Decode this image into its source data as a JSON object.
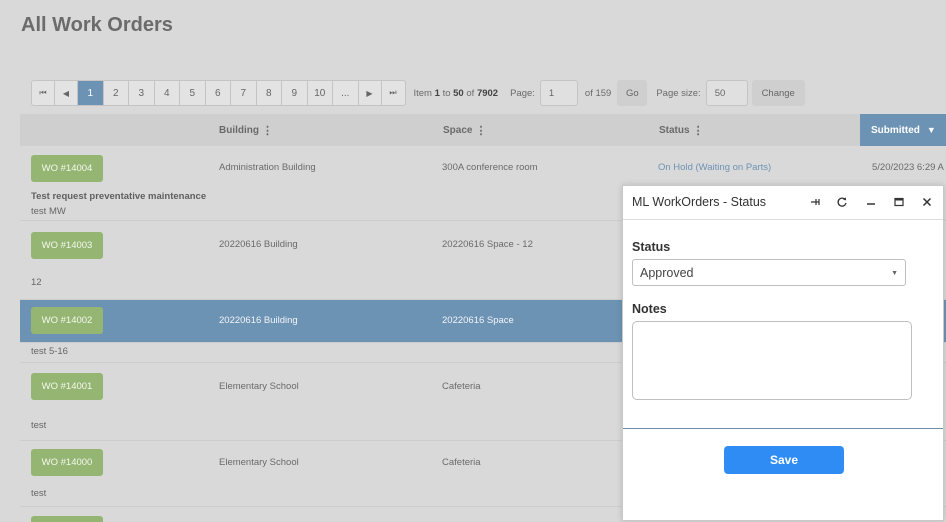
{
  "page": {
    "title": "All Work Orders"
  },
  "pager": {
    "first_icon": "⏮",
    "prev_icon": "◀",
    "pages": [
      "1",
      "2",
      "3",
      "4",
      "5",
      "6",
      "7",
      "8",
      "9",
      "10",
      "..."
    ],
    "next_icon": "▶",
    "last_icon": "⏭",
    "item_prefix": "Item",
    "item_from": "1",
    "item_to_word": "to",
    "item_to": "50",
    "item_of_word": "of",
    "item_total": "7902",
    "page_label": "Page:",
    "page_value": "1",
    "page_of": "of 159",
    "go_label": "Go",
    "page_size_label": "Page size:",
    "page_size_value": "50",
    "change_label": "Change"
  },
  "grid": {
    "columns": {
      "building": "Building",
      "space": "Space",
      "status": "Status",
      "submitted": "Submitted"
    },
    "rows": [
      {
        "wo": "WO #14004",
        "building": "Administration Building",
        "space": "300A conference room",
        "status": "On Hold (Waiting on Parts)",
        "submitted": "5/20/2023 6:29 A",
        "note_title": "Test request preventative maintenance",
        "note": "test MW"
      },
      {
        "wo": "WO #14003",
        "building": "20220616 Building",
        "space": "20220616 Space - 12",
        "note": "12"
      },
      {
        "wo": "WO #14002",
        "building": "20220616 Building",
        "space": "20220616 Space",
        "note": "test 5-16"
      },
      {
        "wo": "WO #14001",
        "building": "Elementary School",
        "space": "Cafeteria",
        "note": "test"
      },
      {
        "wo": "WO #14000",
        "building": "Elementary School",
        "space": "Cafeteria",
        "note": "test"
      }
    ]
  },
  "dialog": {
    "title": "ML WorkOrders - Status",
    "status_label": "Status",
    "status_value": "Approved",
    "notes_label": "Notes",
    "notes_value": "",
    "save_label": "Save",
    "icons": [
      "pin-icon",
      "refresh-icon",
      "minimize-icon",
      "maximize-icon",
      "close-icon"
    ]
  },
  "colors": {
    "accent": "#6d93b4",
    "badge": "#95b573",
    "save": "#2f8cf4"
  }
}
